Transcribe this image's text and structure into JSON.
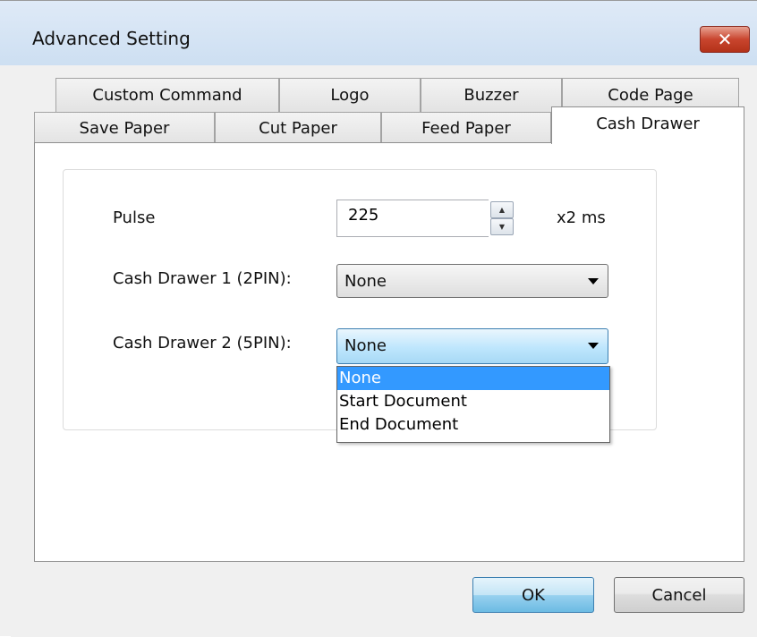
{
  "window": {
    "title": "Advanced Setting",
    "close_glyph": "✕"
  },
  "tabs_row1": [
    {
      "label": "Custom Command"
    },
    {
      "label": "Logo"
    },
    {
      "label": "Buzzer"
    },
    {
      "label": "Code Page"
    }
  ],
  "tabs_row2": [
    {
      "label": "Save Paper"
    },
    {
      "label": "Cut Paper"
    },
    {
      "label": "Feed Paper"
    },
    {
      "label": "Cash Drawer",
      "active": true
    }
  ],
  "form": {
    "pulse_label": "Pulse",
    "pulse_value": "225",
    "pulse_unit": "x2 ms",
    "drawer1_label": "Cash Drawer 1 (2PIN):",
    "drawer1_value": "None",
    "drawer2_label": "Cash Drawer 2 (5PIN):",
    "drawer2_value": "None",
    "drawer2_options": [
      "None",
      "Start Document",
      "End Document"
    ],
    "drawer2_selected": "None"
  },
  "buttons": {
    "ok_label": "OK",
    "cancel_label": "Cancel"
  },
  "icons": {
    "close": "close-icon",
    "spin_up": "up-arrow-icon",
    "spin_down": "down-arrow-icon",
    "dropdown": "chevron-down-icon"
  },
  "colors": {
    "selection": "#3399ff",
    "close_button": "#c9452e",
    "titlebar": "#cddff2"
  }
}
